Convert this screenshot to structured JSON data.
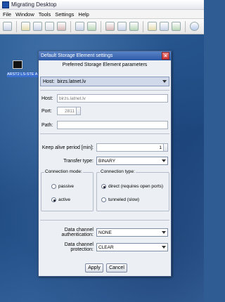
{
  "app": {
    "title": "Migrating Desktop"
  },
  "menu": [
    "File",
    "Window",
    "Tools",
    "Settings",
    "Help"
  ],
  "desktop": {
    "terminal_label": "ARST2 LS-STE A"
  },
  "dialog": {
    "title": "Default Storage Element settings",
    "header": "Preferred Storage Element parameters",
    "host_select_label": "Host:",
    "host_select_value": "birzs.latnet.lv",
    "host_label": "Host:",
    "host_value": "birzs.latnet.lv",
    "port_label": "Port:",
    "port_value": "2811",
    "path_label": "Path:",
    "path_value": "",
    "keep_alive_label": "Keep alive period [min]:",
    "keep_alive_value": "1",
    "transfer_type_label": "Transfer type:",
    "transfer_type_value": "BINARY",
    "connection_mode": {
      "title": "Connection mode:",
      "options": [
        "passive",
        "active"
      ],
      "selected": "active"
    },
    "connection_type": {
      "title": "Connection type:",
      "options": [
        "direct (requires open ports)",
        "tunneled (slow)"
      ],
      "selected": "direct (requires open ports)"
    },
    "auth_label": "Data channel authentication:",
    "auth_value": "NONE",
    "protection_label": "Data channel protection:",
    "protection_value": "CLEAR",
    "apply_label": "Apply",
    "cancel_label": "Cancel"
  }
}
